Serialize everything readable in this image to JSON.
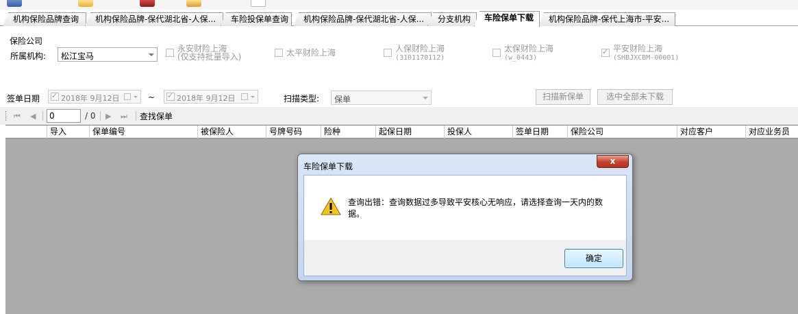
{
  "tabs": [
    {
      "label": "机构保险品牌查询",
      "active": false
    },
    {
      "label": "机构保险品牌-保代湖北省-人保...",
      "active": false
    },
    {
      "label": "车险投保单查询",
      "active": false
    },
    {
      "label": "机构保险品牌-保代湖北省-人保...",
      "active": false
    },
    {
      "label": "分支机构",
      "active": false
    },
    {
      "label": "车险保单下载",
      "active": true
    },
    {
      "label": "机构保险品牌-保代上海市-平安...",
      "active": false
    }
  ],
  "form": {
    "group_label": "保险公司",
    "org_label": "所属机构:",
    "org_value": "松江宝马",
    "companies": [
      {
        "name": "永安财险上海",
        "sub": "(仅支持批量导入)",
        "checked": false
      },
      {
        "name": "太平财险上海",
        "sub": "",
        "checked": false
      },
      {
        "name": "人保财险上海",
        "sub": "(3101170112)",
        "checked": false
      },
      {
        "name": "太保财险上海",
        "sub": "(w_0443)",
        "checked": false
      },
      {
        "name": "平安财险上海",
        "sub": "(SHBJXCBM-00001)",
        "checked": true
      }
    ],
    "sign_date_label": "签单日期",
    "date_from": "2018年 9月12日",
    "date_sep": "~",
    "date_to": "2018年 9月12日",
    "scan_type_label": "扫描类型:",
    "scan_type_value": "保单",
    "scan_new_button": "扫描新保单",
    "select_all_button": "选中全部未下载"
  },
  "navigator": {
    "page_value": "0",
    "total": "/ 0",
    "find_label": "查找保单"
  },
  "grid": {
    "columns": [
      "导入",
      "保单编号",
      "被保险人",
      "号牌号码",
      "险种",
      "起保日期",
      "投保人",
      "签单日期",
      "保险公司",
      "对应客户",
      "对应业务员"
    ]
  },
  "dialog": {
    "title": "车险保单下载",
    "close_label": "x",
    "message": "查询出错：查询数据过多导致平安核心无响应，请选择查询一天内的数据。",
    "ok_label": "确定"
  },
  "colors": {
    "dialog_frame": "#c4d6ee",
    "close_button": "#c4432d",
    "grid_background": "#ababab"
  }
}
